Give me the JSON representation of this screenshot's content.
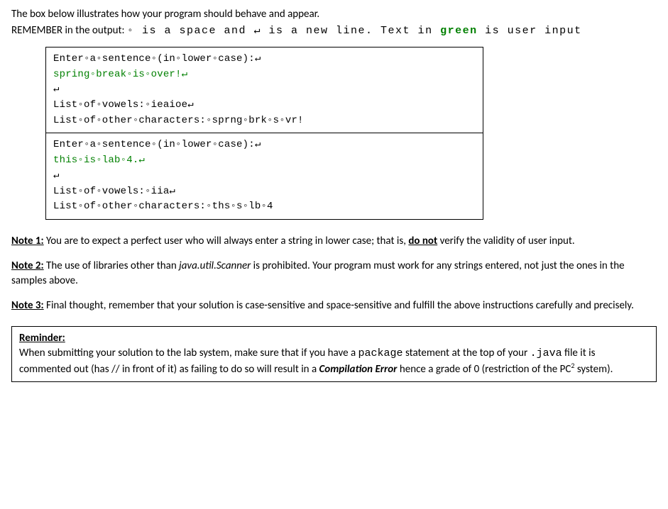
{
  "intro": {
    "line1": "The box below illustrates how your program should behave and appear.",
    "line2_prefix": "REMEMBER in the output: ",
    "space_sym": "◦",
    "is_a_space_and": " is a space and ",
    "newline_sym": "↵",
    "is_a_new_line": " is a new line. Text in ",
    "green_word": "green",
    "is_user_input": " is user input"
  },
  "example1": {
    "l1": "Enter◦a◦sentence◦(in◦lower◦case):↵",
    "l2": "spring◦break◦is◦over!↵",
    "l3": "↵",
    "l4": "List◦of◦vowels:◦ieaioe↵",
    "l5": "List◦of◦other◦characters:◦sprng◦brk◦s◦vr!"
  },
  "example2": {
    "l1": "Enter◦a◦sentence◦(in◦lower◦case):↵",
    "l2": "this◦is◦lab◦4.↵",
    "l3": "↵",
    "l4": "List◦of◦vowels:◦iia↵",
    "l5": "List◦of◦other◦characters:◦ths◦s◦lb◦4"
  },
  "notes": {
    "n1_label": "Note 1:",
    "n1_a": " You are to expect a perfect user who will always enter a string in lower case; that is, ",
    "n1_donot": "do not",
    "n1_b": " verify the validity of user input.",
    "n2_label": "Note 2:",
    "n2_a": " The use of libraries other than ",
    "n2_lib": "java.util.Scanner",
    "n2_b": " is prohibited. Your program must work for any strings entered, not just the ones in the samples above.",
    "n3_label": "Note 3:",
    "n3_body": " Final thought, remember that your solution is case-sensitive and space-sensitive and fulfill the above instructions carefully and precisely."
  },
  "reminder": {
    "label": "Reminder:",
    "a": "When submitting your solution to the lab system, make sure that  if you have a ",
    "package_word": "package",
    "b": " statement at the top of your ",
    "java_word": ".java",
    "c": " file it is commented out (has // in front of it) as failing to do so will result in a ",
    "comp_error": "Compilation Error",
    "d": " hence a grade of 0 (restriction of the PC",
    "sup": "2",
    "e": " system)."
  }
}
